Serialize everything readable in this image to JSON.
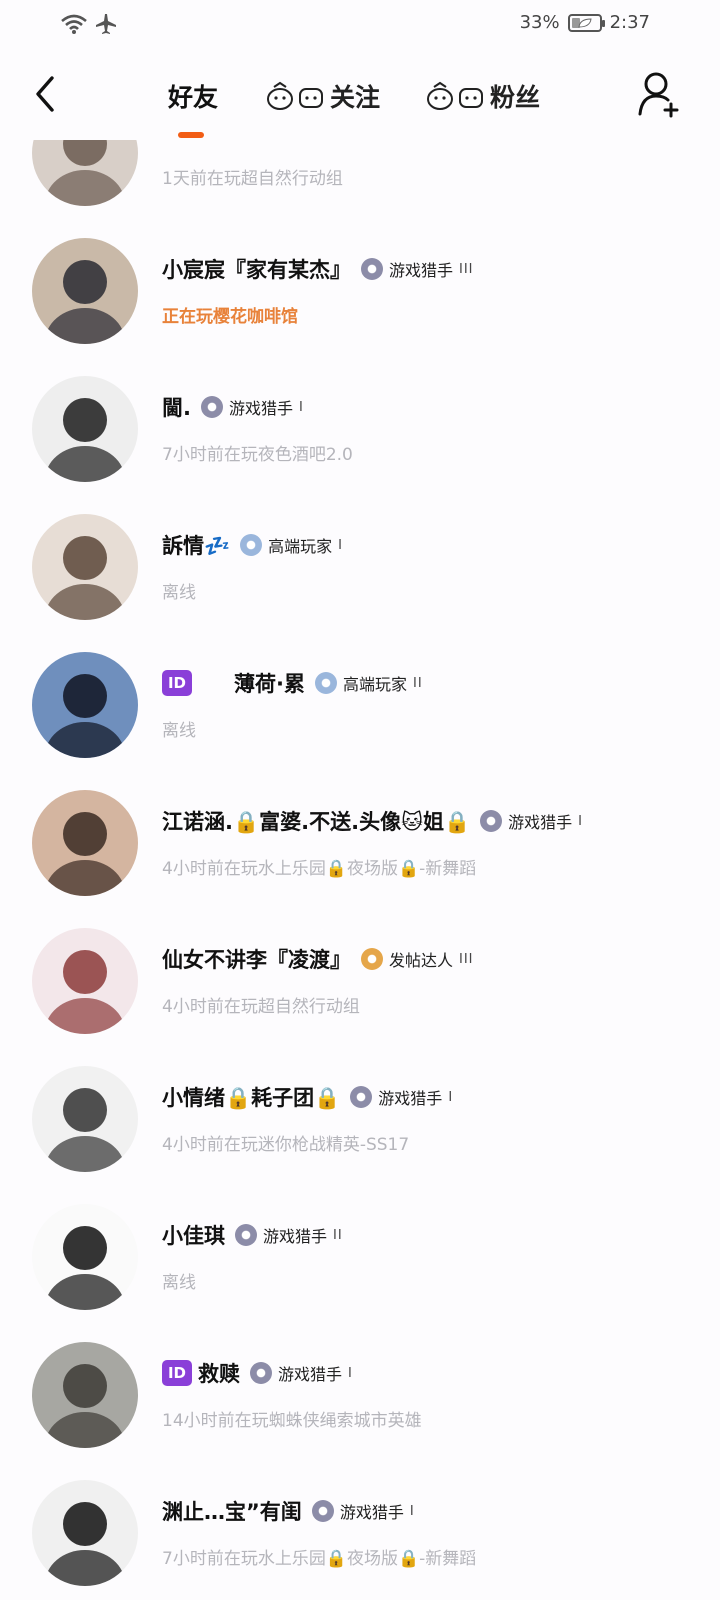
{
  "status": {
    "battery_text": "33%",
    "battery_level": 0.33,
    "time": "2:37",
    "icons": [
      "wifi-icon",
      "airplane-icon",
      "battery-icon"
    ]
  },
  "nav": {
    "tabs": [
      {
        "label": "好友"
      },
      {
        "label": "关注"
      },
      {
        "label": "粉丝"
      }
    ],
    "active_tab": 0,
    "accent_color": "#f25d15"
  },
  "friends": [
    {
      "name": "",
      "rank": "",
      "level": "",
      "status": "1天前在玩超自然行动组"
    },
    {
      "name": "小宸宸『家有某杰』",
      "rank": "游戏猎手",
      "level": "III",
      "status": "正在玩樱花咖啡馆",
      "playing": true
    },
    {
      "name": "閫.",
      "rank": "游戏猎手",
      "level": "I",
      "status": "7小时前在玩夜色酒吧2.0"
    },
    {
      "name": "訴情💤",
      "rank": "高端玩家",
      "level": "I",
      "status": "离线"
    },
    {
      "name": "薄荷·累",
      "id_badge": "ID",
      "rank": "高端玩家",
      "level": "II",
      "status": "离线"
    },
    {
      "name": "江诺涵.🔒富婆.不送.头像🐱姐🔒",
      "rank": "游戏猎手",
      "level": "I",
      "status": "4小时前在玩水上乐园🔒夜场版🔒-新舞蹈"
    },
    {
      "name": "仙女不讲李『凌渡』",
      "rank": "发帖达人",
      "level": "III",
      "status": "4小时前在玩超自然行动组"
    },
    {
      "name": "小情绪🔒耗子团🔒",
      "rank": "游戏猎手",
      "level": "I",
      "status": "4小时前在玩迷你枪战精英-SS17"
    },
    {
      "name": "小佳琪",
      "rank": "游戏猎手",
      "level": "II",
      "status": "离线"
    },
    {
      "name": "救赎",
      "id_badge": "ID",
      "rank": "游戏猎手",
      "level": "I",
      "status": "14小时前在玩蜘蛛侠绳索城市英雄"
    },
    {
      "name": "渊止…宝”有闺",
      "rank": "游戏猎手",
      "level": "I",
      "status": "7小时前在玩水上乐园🔒夜场版🔒-新舞蹈"
    }
  ]
}
